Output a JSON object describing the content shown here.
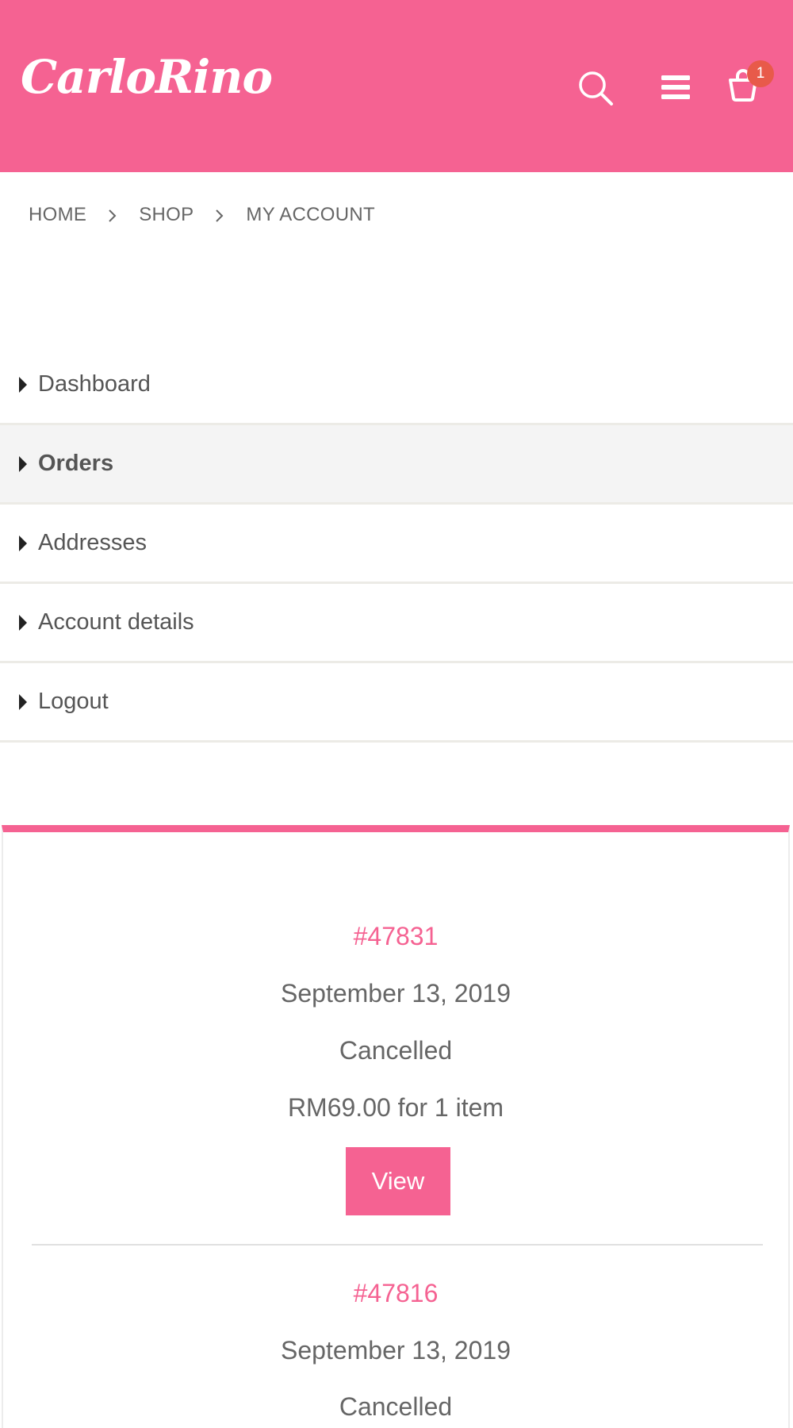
{
  "header": {
    "logo_text": "CarloRino",
    "cart_count": "1",
    "icons": [
      "search-icon",
      "menu-icon",
      "cart-icon"
    ],
    "brand_color": "#f56292"
  },
  "breadcrumb": [
    "HOME",
    "SHOP",
    "MY ACCOUNT"
  ],
  "account_nav": {
    "active": "Orders",
    "items": [
      "Dashboard",
      "Orders",
      "Addresses",
      "Account details",
      "Logout"
    ]
  },
  "orders": [
    {
      "number": "#47831",
      "date": "September 13, 2019",
      "status": "Cancelled",
      "total": "RM69.00 for 1 item",
      "action_label": "View"
    },
    {
      "number": "#47816",
      "date": "September 13, 2019",
      "status": "Cancelled"
    }
  ]
}
